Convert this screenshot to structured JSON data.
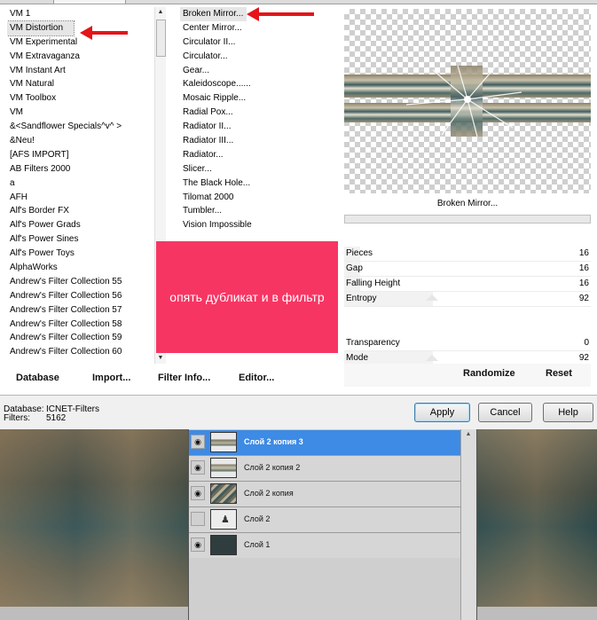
{
  "categories": [
    "VM 1",
    "VM Distortion",
    "VM Experimental",
    "VM Extravaganza",
    "VM Instant Art",
    "VM Natural",
    "VM Toolbox",
    "VM",
    "&<Sandflower Specials^v^ >",
    "&Neu!",
    "[AFS IMPORT]",
    "AB Filters 2000",
    "a",
    "AFH",
    "Alf's Border FX",
    "Alf's Power Grads",
    "Alf's Power Sines",
    "Alf's Power Toys",
    "AlphaWorks",
    "Andrew's Filter Collection 55",
    "Andrew's Filter Collection 56",
    "Andrew's Filter Collection 57",
    "Andrew's Filter Collection 58",
    "Andrew's Filter Collection 59",
    "Andrew's Filter Collection 60"
  ],
  "filters": [
    "Broken Mirror...",
    "Center Mirror...",
    "Circulator II...",
    "Circulator...",
    "Gear...",
    "Kaleidoscope......",
    "Mosaic Ripple...",
    "Radial Pox...",
    "Radiator II...",
    "Radiator III...",
    "Radiator...",
    "Slicer...",
    "The Black Hole...",
    "Tilomat 2000",
    "Tumbler...",
    "Vision Impossible"
  ],
  "plugin_buttons": {
    "database": "Database",
    "import": "Import...",
    "filter_info": "Filter Info...",
    "editor": "Editor..."
  },
  "preview_label": "Broken Mirror...",
  "params_top": [
    {
      "name": "Pieces",
      "value": "16",
      "fraction": 0.064
    },
    {
      "name": "Gap",
      "value": "16",
      "fraction": 0.064
    },
    {
      "name": "Falling Height",
      "value": "16",
      "fraction": 0.064
    },
    {
      "name": "Entropy",
      "value": "92",
      "fraction": 0.36
    }
  ],
  "params_bottom": [
    {
      "name": "Transparency",
      "value": "0",
      "fraction": 0
    },
    {
      "name": "Mode",
      "value": "92",
      "fraction": 0.36
    }
  ],
  "right_buttons": {
    "randomize": "Randomize",
    "reset": "Reset"
  },
  "annotation": "опять дубликат и в фильтр",
  "status": {
    "database_label": "Database:",
    "database_value": "ICNET-Filters",
    "filters_label": "Filters:",
    "filters_value": "5162"
  },
  "dialog_buttons": {
    "apply": "Apply",
    "cancel": "Cancel",
    "help": "Help"
  },
  "layers": [
    {
      "name": "Слой 2 копия 3",
      "visible": true,
      "active": true
    },
    {
      "name": "Слой 2 копия 2",
      "visible": true,
      "active": false
    },
    {
      "name": "Слой 2 копия",
      "visible": true,
      "active": false
    },
    {
      "name": "Слой 2",
      "visible": false,
      "active": false
    },
    {
      "name": "Слой 1",
      "visible": true,
      "active": false
    }
  ],
  "colors": {
    "accent_red": "#e4141a",
    "annotation_pink": "#f73563",
    "active_layer_blue": "#3d8be5"
  }
}
